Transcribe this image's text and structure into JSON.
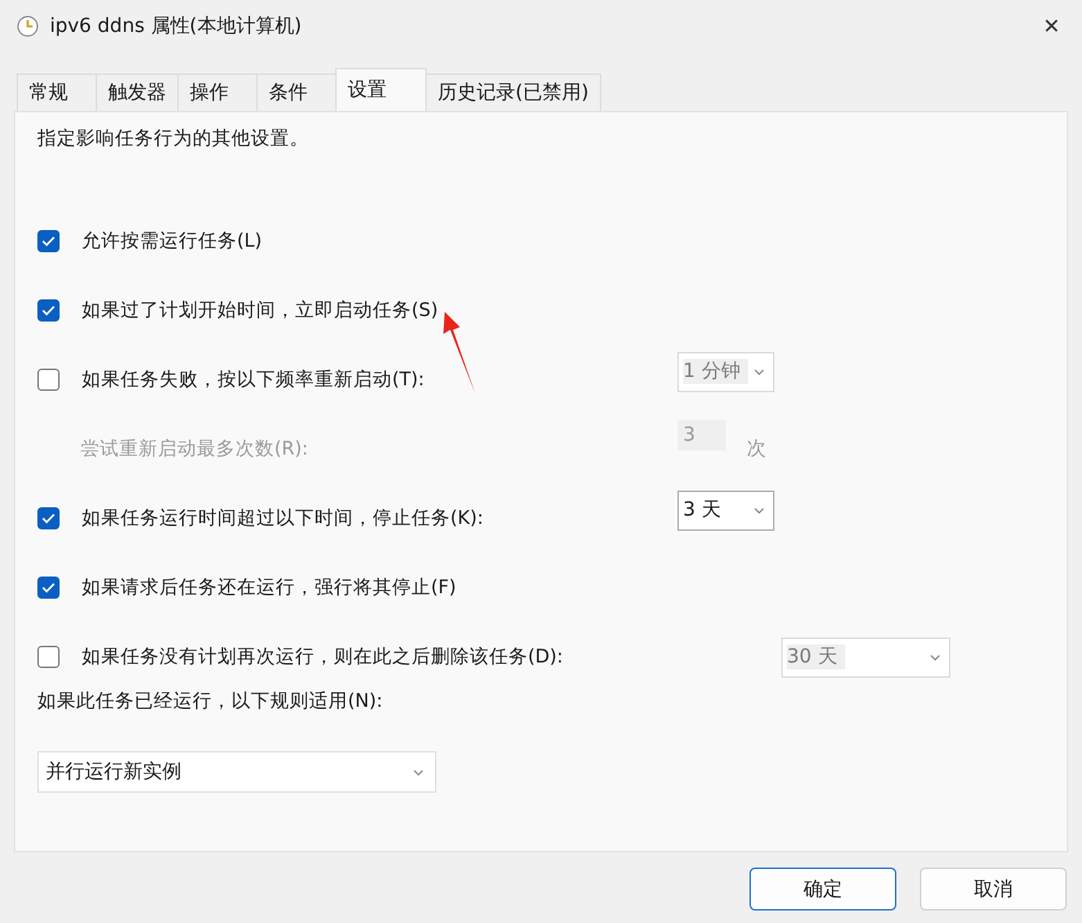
{
  "window": {
    "title": "ipv6 ddns 属性(本地计算机)",
    "close": "✕"
  },
  "tabs": [
    {
      "label": "常规",
      "selected": false
    },
    {
      "label": "触发器",
      "selected": false
    },
    {
      "label": "操作",
      "selected": false
    },
    {
      "label": "条件",
      "selected": false
    },
    {
      "label": "设置",
      "selected": true
    },
    {
      "label": "历史记录(已禁用)",
      "selected": false
    }
  ],
  "intro": "指定影响任务行为的其他设置。",
  "settings": [
    {
      "kind": "checkbox",
      "label": "允许按需运行任务(L)",
      "checked": true
    },
    {
      "kind": "checkbox",
      "label": "如果过了计划开始时间，立即启动任务(S)",
      "checked": true
    },
    {
      "kind": "checkbox",
      "label": "如果任务失败，按以下频率重新启动(T):",
      "checked": false,
      "dropdown": {
        "value": "1 分钟",
        "disabled": true
      }
    },
    {
      "kind": "spin",
      "label": "尝试重新启动最多次数(R):",
      "value": "3",
      "unit": "次",
      "disabled": true
    },
    {
      "kind": "checkbox",
      "label": "如果任务运行时间超过以下时间，停止任务(K):",
      "checked": true,
      "dropdown": {
        "value": "3 天",
        "disabled": false
      }
    },
    {
      "kind": "checkbox",
      "label": "如果请求后任务还在运行，强行将其停止(F)",
      "checked": true
    },
    {
      "kind": "checkbox",
      "label": "如果任务没有计划再次运行，则在此之后删除该任务(D):",
      "checked": false,
      "dropdown": {
        "value": "30 天",
        "disabled": true
      }
    }
  ],
  "rule": {
    "label": "如果此任务已经运行，以下规则适用(N):",
    "value": "并行运行新实例"
  },
  "buttons": [
    {
      "label": "确定",
      "default": true
    },
    {
      "label": "取消",
      "default": false
    }
  ]
}
